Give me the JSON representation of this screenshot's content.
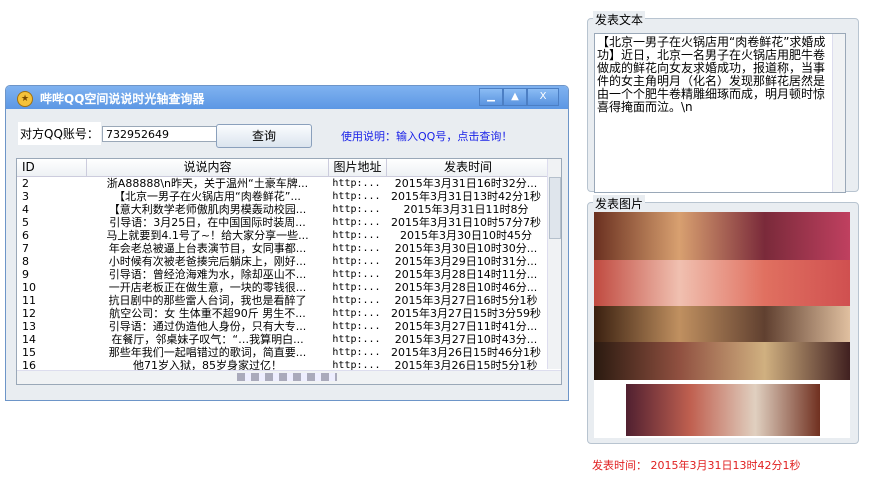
{
  "window": {
    "title": "哔哔QQ空间说说时光轴查询器",
    "minimize": "▁",
    "maximize": "▲",
    "close": "X"
  },
  "form": {
    "label": "对方QQ账号：",
    "qq_value": "732952649",
    "query_button": "查询",
    "help": "使用说明：输入QQ号，点击查询！"
  },
  "table": {
    "headers": [
      "ID",
      "说说内容",
      "图片地址",
      "发表时间"
    ],
    "rows": [
      [
        "2",
        "浙A88888\\n昨天，关于温州“土豪车牌...",
        "http:...",
        "2015年3月31日16时32分..."
      ],
      [
        "3",
        "【北京一男子在火锅店用“肉卷鲜花”...",
        "http:...",
        "2015年3月31日13时42分1秒"
      ],
      [
        "4",
        "【意大利数学老师傲肌肉男模轰动校园...",
        "http:...",
        "2015年3月31日11时8分"
      ],
      [
        "5",
        "引导语：3月25日，在中国国际时装周...",
        "http:...",
        "2015年3月31日10时57分7秒"
      ],
      [
        "6",
        "马上就要到4.1号了~！给大家分享一些...",
        "http:...",
        "2015年3月30日10时45分"
      ],
      [
        "7",
        "年会老总被逼上台表演节目，女同事都...",
        "http:...",
        "2015年3月30日10时30分..."
      ],
      [
        "8",
        "小时候有次被老爸揍完后躺床上，刚好...",
        "http:...",
        "2015年3月29日10时31分..."
      ],
      [
        "9",
        "引导语：曾经沧海难为水，除却巫山不...",
        "http:...",
        "2015年3月28日14时11分..."
      ],
      [
        "10",
        "一开店老板正在做生意，一块的零钱很...",
        "http:...",
        "2015年3月28日10时46分..."
      ],
      [
        "11",
        "抗日剧中的那些雷人台词，我也是看醉了",
        "http:...",
        "2015年3月27日16时5分1秒"
      ],
      [
        "12",
        "航空公司：女 生体重不超90斤 男生不...",
        "http:...",
        "2015年3月27日15时3分59秒"
      ],
      [
        "13",
        "引导语：通过伪造他人身份，只有大专...",
        "http:...",
        "2015年3月27日11时41分..."
      ],
      [
        "14",
        "在餐厅，邻桌妹子叹气：“…我算明白...",
        "http:...",
        "2015年3月27日10时43分..."
      ],
      [
        "15",
        "那些年我们一起唱错过的歌词，简直要...",
        "http:...",
        "2015年3月26日15时46分1秒"
      ],
      [
        "16",
        "他71岁入狱，85岁身家过亿！",
        "http:...",
        "2015年3月26日15时5分1秒"
      ]
    ]
  },
  "post_text": {
    "title": "发表文本",
    "content": "【北京一男子在火锅店用“肉卷鲜花”求婚成功】近日，北京一名男子在火锅店用肥牛卷做成的鲜花向女友求婚成功，报道称，当事件的女主角明月（化名）发现那鲜花居然是由一个个肥牛卷精雕细琢而成，明月顿时惊喜得掩面而泣。\\n"
  },
  "post_image": {
    "title": "发表图片"
  },
  "footer": {
    "label": "发表时间：",
    "time": "2015年3月31日13时42分1秒"
  }
}
